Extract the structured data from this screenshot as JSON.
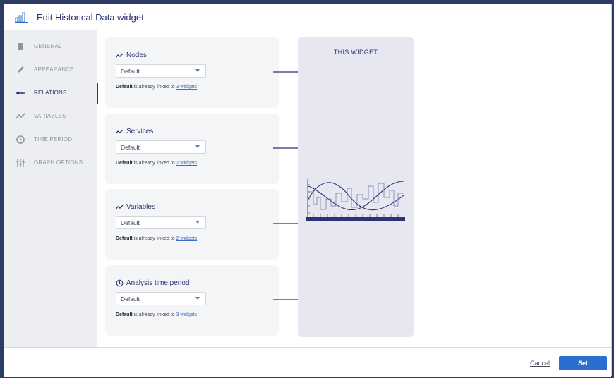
{
  "dialog": {
    "title": "Edit Historical Data widget"
  },
  "sidebar": {
    "items": [
      {
        "label": "GENERAL",
        "icon": "database-icon"
      },
      {
        "label": "APPEARANCE",
        "icon": "pencil-icon"
      },
      {
        "label": "RELATIONS",
        "icon": "relations-icon",
        "active": true
      },
      {
        "label": "VARIABLES",
        "icon": "trend-line-icon"
      },
      {
        "label": "TIME PERIOD",
        "icon": "clock-icon"
      },
      {
        "label": "GRAPH OPTIONS",
        "icon": "sliders-icon"
      }
    ]
  },
  "relations": [
    {
      "title": "Nodes",
      "icon": "trend-line-icon",
      "selected": "Default",
      "bold": "Default",
      "text": " is already linked to ",
      "link": "3 widgets"
    },
    {
      "title": "Services",
      "icon": "trend-line-icon",
      "selected": "Default",
      "bold": "Default",
      "text": " is already linked to ",
      "link": "2 widgets"
    },
    {
      "title": "Variables",
      "icon": "trend-line-icon",
      "selected": "Default",
      "bold": "Default",
      "text": " is already linked to ",
      "link": "2 widgets"
    },
    {
      "title": "Analysis time period",
      "icon": "clock-icon",
      "selected": "Default",
      "bold": "Default",
      "text": " is already linked to ",
      "link": "3 widgets"
    }
  ],
  "panel": {
    "title": "THIS WIDGET"
  },
  "footer": {
    "cancel": "Cancel",
    "set": "Set"
  },
  "colors": {
    "accent": "#2d3275",
    "primary_button": "#2a6fcf",
    "link": "#3e6fd0"
  }
}
